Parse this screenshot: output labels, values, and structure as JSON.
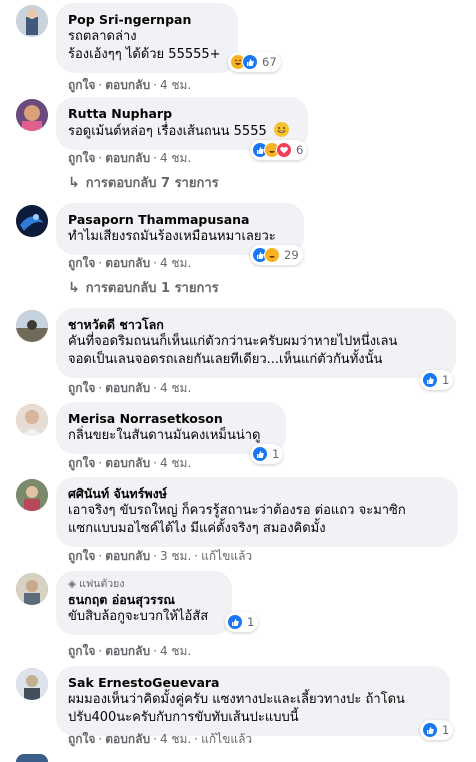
{
  "actions": {
    "like": "ถูกใจ",
    "reply": "ตอบกลับ",
    "edited": "แก้ไขแล้ว"
  },
  "colors": {
    "bubble": "#f0f2f5",
    "meta": "#65676b",
    "like": "#1877f2",
    "haha": "#f7b125",
    "love": "#f33e58"
  },
  "comments": [
    {
      "author": "Pop Sri-ngernpan",
      "lines": [
        "รถตลาดล่าง",
        "ร้องเอ้งๆๆ ได้ด้วย 55555+"
      ],
      "time": "4 ชม.",
      "reaction_count": "67",
      "reactions": [
        "haha-icon",
        "like-icon"
      ]
    },
    {
      "author": "Rutta Nupharp",
      "lines": [
        "รอดูเม้นต์หล่อๆ เรื่องเส้นถนน 5555"
      ],
      "time": "4 ชม.",
      "reaction_count": "6",
      "reactions": [
        "like-icon",
        "haha-icon",
        "love-icon"
      ],
      "emoji": "grin-emoji-icon",
      "replies_label": "การตอบกลับ 7 รายการ"
    },
    {
      "author": "Pasaporn Thammapusana",
      "lines": [
        "ทำไมเสียงรถมันร้องเหมือนหมาเลยวะ"
      ],
      "time": "4 ชม.",
      "reaction_count": "29",
      "reactions": [
        "like-icon",
        "haha-icon"
      ],
      "replies_label": "การตอบกลับ 1 รายการ"
    },
    {
      "author": "ชาหวัดดี ชาวโลก",
      "lines": [
        "คันที่จอดริมถนนก็เห็นแก่ตัวกว่านะครับผมว่าหายไปหนึ่งเลน",
        "จอดเป็นเลนจอดรถเลยกันเลยทีเดียว...เห็นแก่ตัวกันทั้งนั้น"
      ],
      "time": "4 ชม.",
      "reaction_count": "1",
      "reactions": [
        "like-icon"
      ]
    },
    {
      "author": "Merisa Norrasetkoson",
      "lines": [
        "กลิ่นขยะในสันดานมันคงเหม็นน่าดู"
      ],
      "time": "4 ชม.",
      "reaction_count": "1",
      "reactions": [
        "like-icon"
      ]
    },
    {
      "author": "ศศินันท์ จันทร์พงษ์",
      "lines": [
        "เอาจริงๆ ขับรถใหญ่ ก็ควรรู้สถานะว่าต้องรอ ต่อแถว จะมาซิก",
        "แซกแบบมอไซค์ได้ไง มีแค่ตั้งจริงๆ สมองคิดมั้ง"
      ],
      "time": "3 ชม.",
      "edited": true
    },
    {
      "author": "ธนกฤต อ่อนสุวรรณ",
      "fan_badge": "แฟนตัวยง",
      "lines": [
        "ขับสิบล้อกูจะบวกให้ไอ้สัส"
      ],
      "time": "4 ชม.",
      "reaction_count": "1",
      "reactions": [
        "like-icon"
      ]
    },
    {
      "author": "Sak ErnestoGeuevara",
      "lines": [
        "ผมมองเห็นว่าคิดมั้งคู่ครับ แซงทางปะและเลี้ยวทางปะ ถ้าโดน",
        "ปรับ400นะครับกับการขับทับเส้นปะแบบนี้"
      ],
      "time": "4 ชม.",
      "reaction_count": "1",
      "reactions": [
        "like-icon"
      ],
      "edited": true
    }
  ]
}
